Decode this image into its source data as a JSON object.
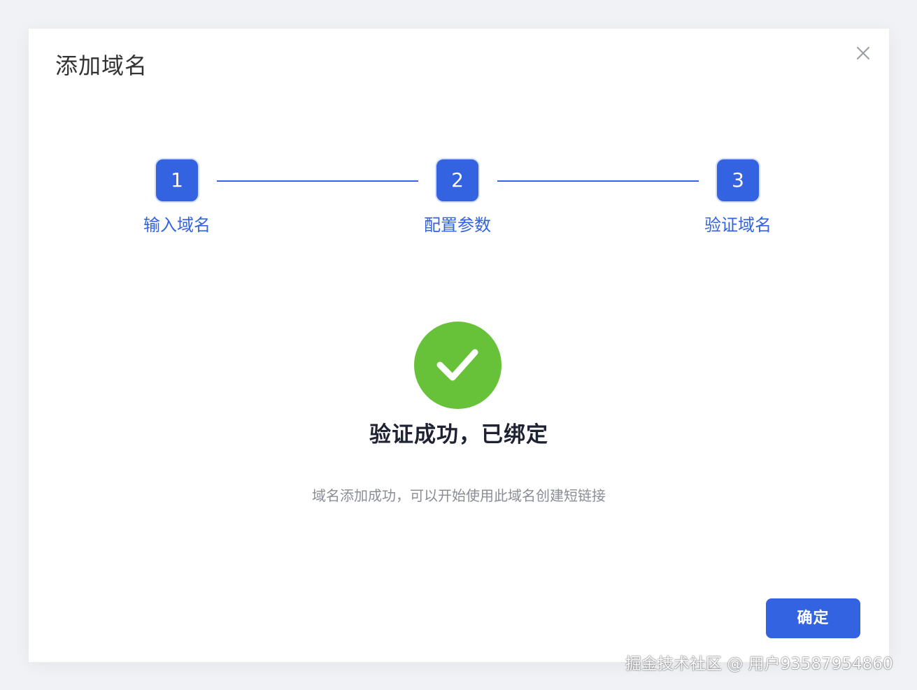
{
  "dialog": {
    "title": "添加域名",
    "close_icon": "close-icon"
  },
  "steps": [
    {
      "number": "1",
      "label": "输入域名",
      "state": "completed"
    },
    {
      "number": "2",
      "label": "配置参数",
      "state": "completed"
    },
    {
      "number": "3",
      "label": "验证域名",
      "state": "completed"
    }
  ],
  "result": {
    "icon": "check-circle-icon",
    "title": "验证成功，已绑定",
    "description": "域名添加成功，可以开始使用此域名创建短链接"
  },
  "footer": {
    "confirm_label": "确定"
  },
  "watermark": {
    "text": "掘金技术社区 @ 用户93587954860"
  },
  "colors": {
    "primary": "#3363e0",
    "success": "#67c23a",
    "title_text": "#333333",
    "desc_text": "#8a8d96"
  }
}
